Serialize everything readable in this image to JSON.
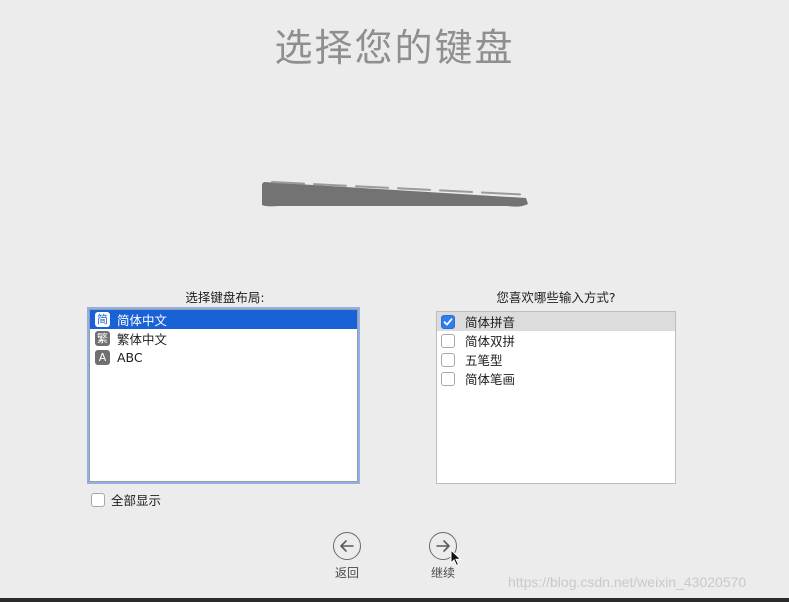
{
  "title": "选择您的键盘",
  "layout_panel": {
    "label": "选择键盘布局:",
    "items": [
      {
        "glyph": "简",
        "label": "简体中文",
        "selected": true
      },
      {
        "glyph": "繁",
        "label": "繁体中文",
        "selected": false
      },
      {
        "glyph": "A",
        "label": "ABC",
        "selected": false
      }
    ]
  },
  "method_panel": {
    "label": "您喜欢哪些输入方式?",
    "items": [
      {
        "label": "简体拼音",
        "checked": true
      },
      {
        "label": "简体双拼",
        "checked": false
      },
      {
        "label": "五笔型",
        "checked": false
      },
      {
        "label": "简体笔画",
        "checked": false
      }
    ]
  },
  "show_all": {
    "label": "全部显示",
    "checked": false
  },
  "nav": {
    "back_label": "返回",
    "next_label": "继续"
  },
  "watermark": "https://blog.csdn.net/weixin_43020570",
  "icons": {
    "back": "arrow-left-circle-icon",
    "next": "arrow-right-circle-icon",
    "keyboard": "keyboard-illustration"
  },
  "colors": {
    "selection": "#1961d6",
    "checkbox_checked": "#2f7ef0",
    "title": "#8f8f8f",
    "background": "#ececec"
  }
}
